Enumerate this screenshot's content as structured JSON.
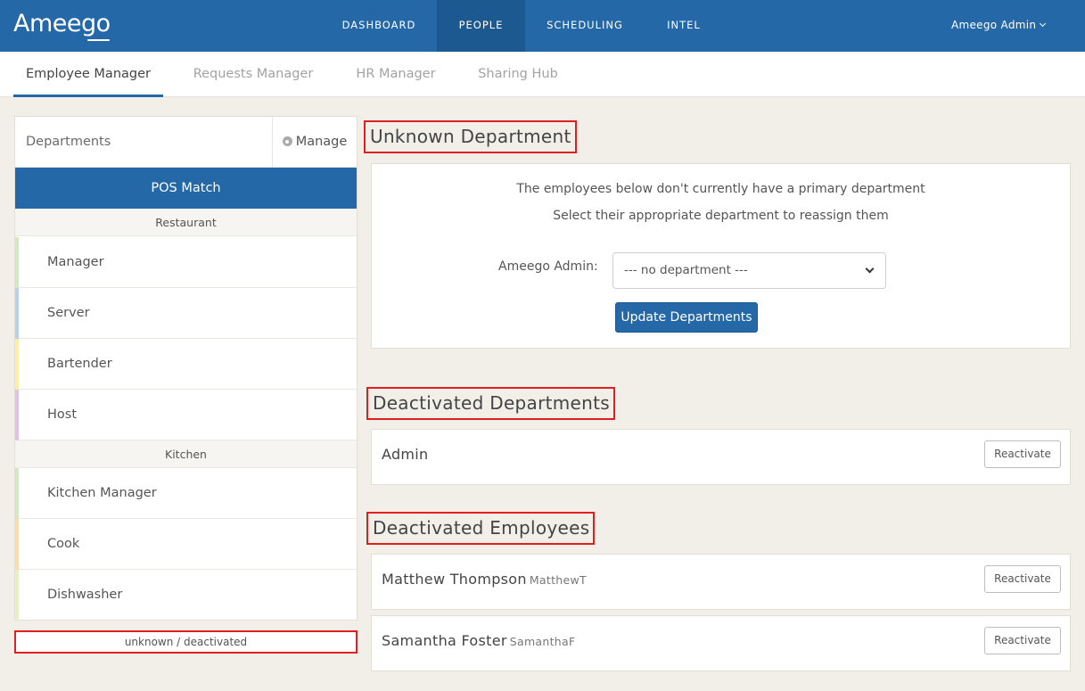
{
  "app": {
    "logo": "Ameego"
  },
  "nav": {
    "items": [
      {
        "label": "DASHBOARD",
        "active": false
      },
      {
        "label": "PEOPLE",
        "active": true
      },
      {
        "label": "SCHEDULING",
        "active": false
      },
      {
        "label": "INTEL",
        "active": false
      }
    ],
    "user_menu": "Ameego Admin"
  },
  "subtabs": [
    {
      "label": "Employee Manager",
      "active": true
    },
    {
      "label": "Requests Manager",
      "active": false
    },
    {
      "label": "HR Manager",
      "active": false
    },
    {
      "label": "Sharing Hub",
      "active": false
    }
  ],
  "sidebar": {
    "title": "Departments",
    "manage_label": "Manage",
    "pos_match_label": "POS Match",
    "groups": [
      {
        "name": "Restaurant",
        "items": [
          {
            "label": "Manager",
            "color": "#d4e8c4"
          },
          {
            "label": "Server",
            "color": "#b9d0ea"
          },
          {
            "label": "Bartender",
            "color": "#f7f0a6"
          },
          {
            "label": "Host",
            "color": "#e0c2e6"
          }
        ]
      },
      {
        "name": "Kitchen",
        "items": [
          {
            "label": "Kitchen Manager",
            "color": "#d4e8c4"
          },
          {
            "label": "Cook",
            "color": "#fbdcb0"
          },
          {
            "label": "Dishwasher",
            "color": "#e6f0c4"
          }
        ]
      }
    ],
    "unknown_link": "unknown / deactivated"
  },
  "unknown_department": {
    "title": "Unknown Department",
    "message_line1": "The employees below don't currently have a primary department",
    "message_line2": "Select their appropriate department to reassign them",
    "employee_label": "Ameego Admin:",
    "select_value": "--- no department ---",
    "update_button": "Update Departments"
  },
  "deactivated_departments": {
    "title": "Deactivated Departments",
    "rows": [
      {
        "name": "Admin",
        "button": "Reactivate"
      }
    ]
  },
  "deactivated_employees": {
    "title": "Deactivated Employees",
    "rows": [
      {
        "name": "Matthew Thompson",
        "username": "MatthewT",
        "button": "Reactivate"
      },
      {
        "name": "Samantha Foster",
        "username": "SamanthaF",
        "button": "Reactivate"
      }
    ]
  }
}
